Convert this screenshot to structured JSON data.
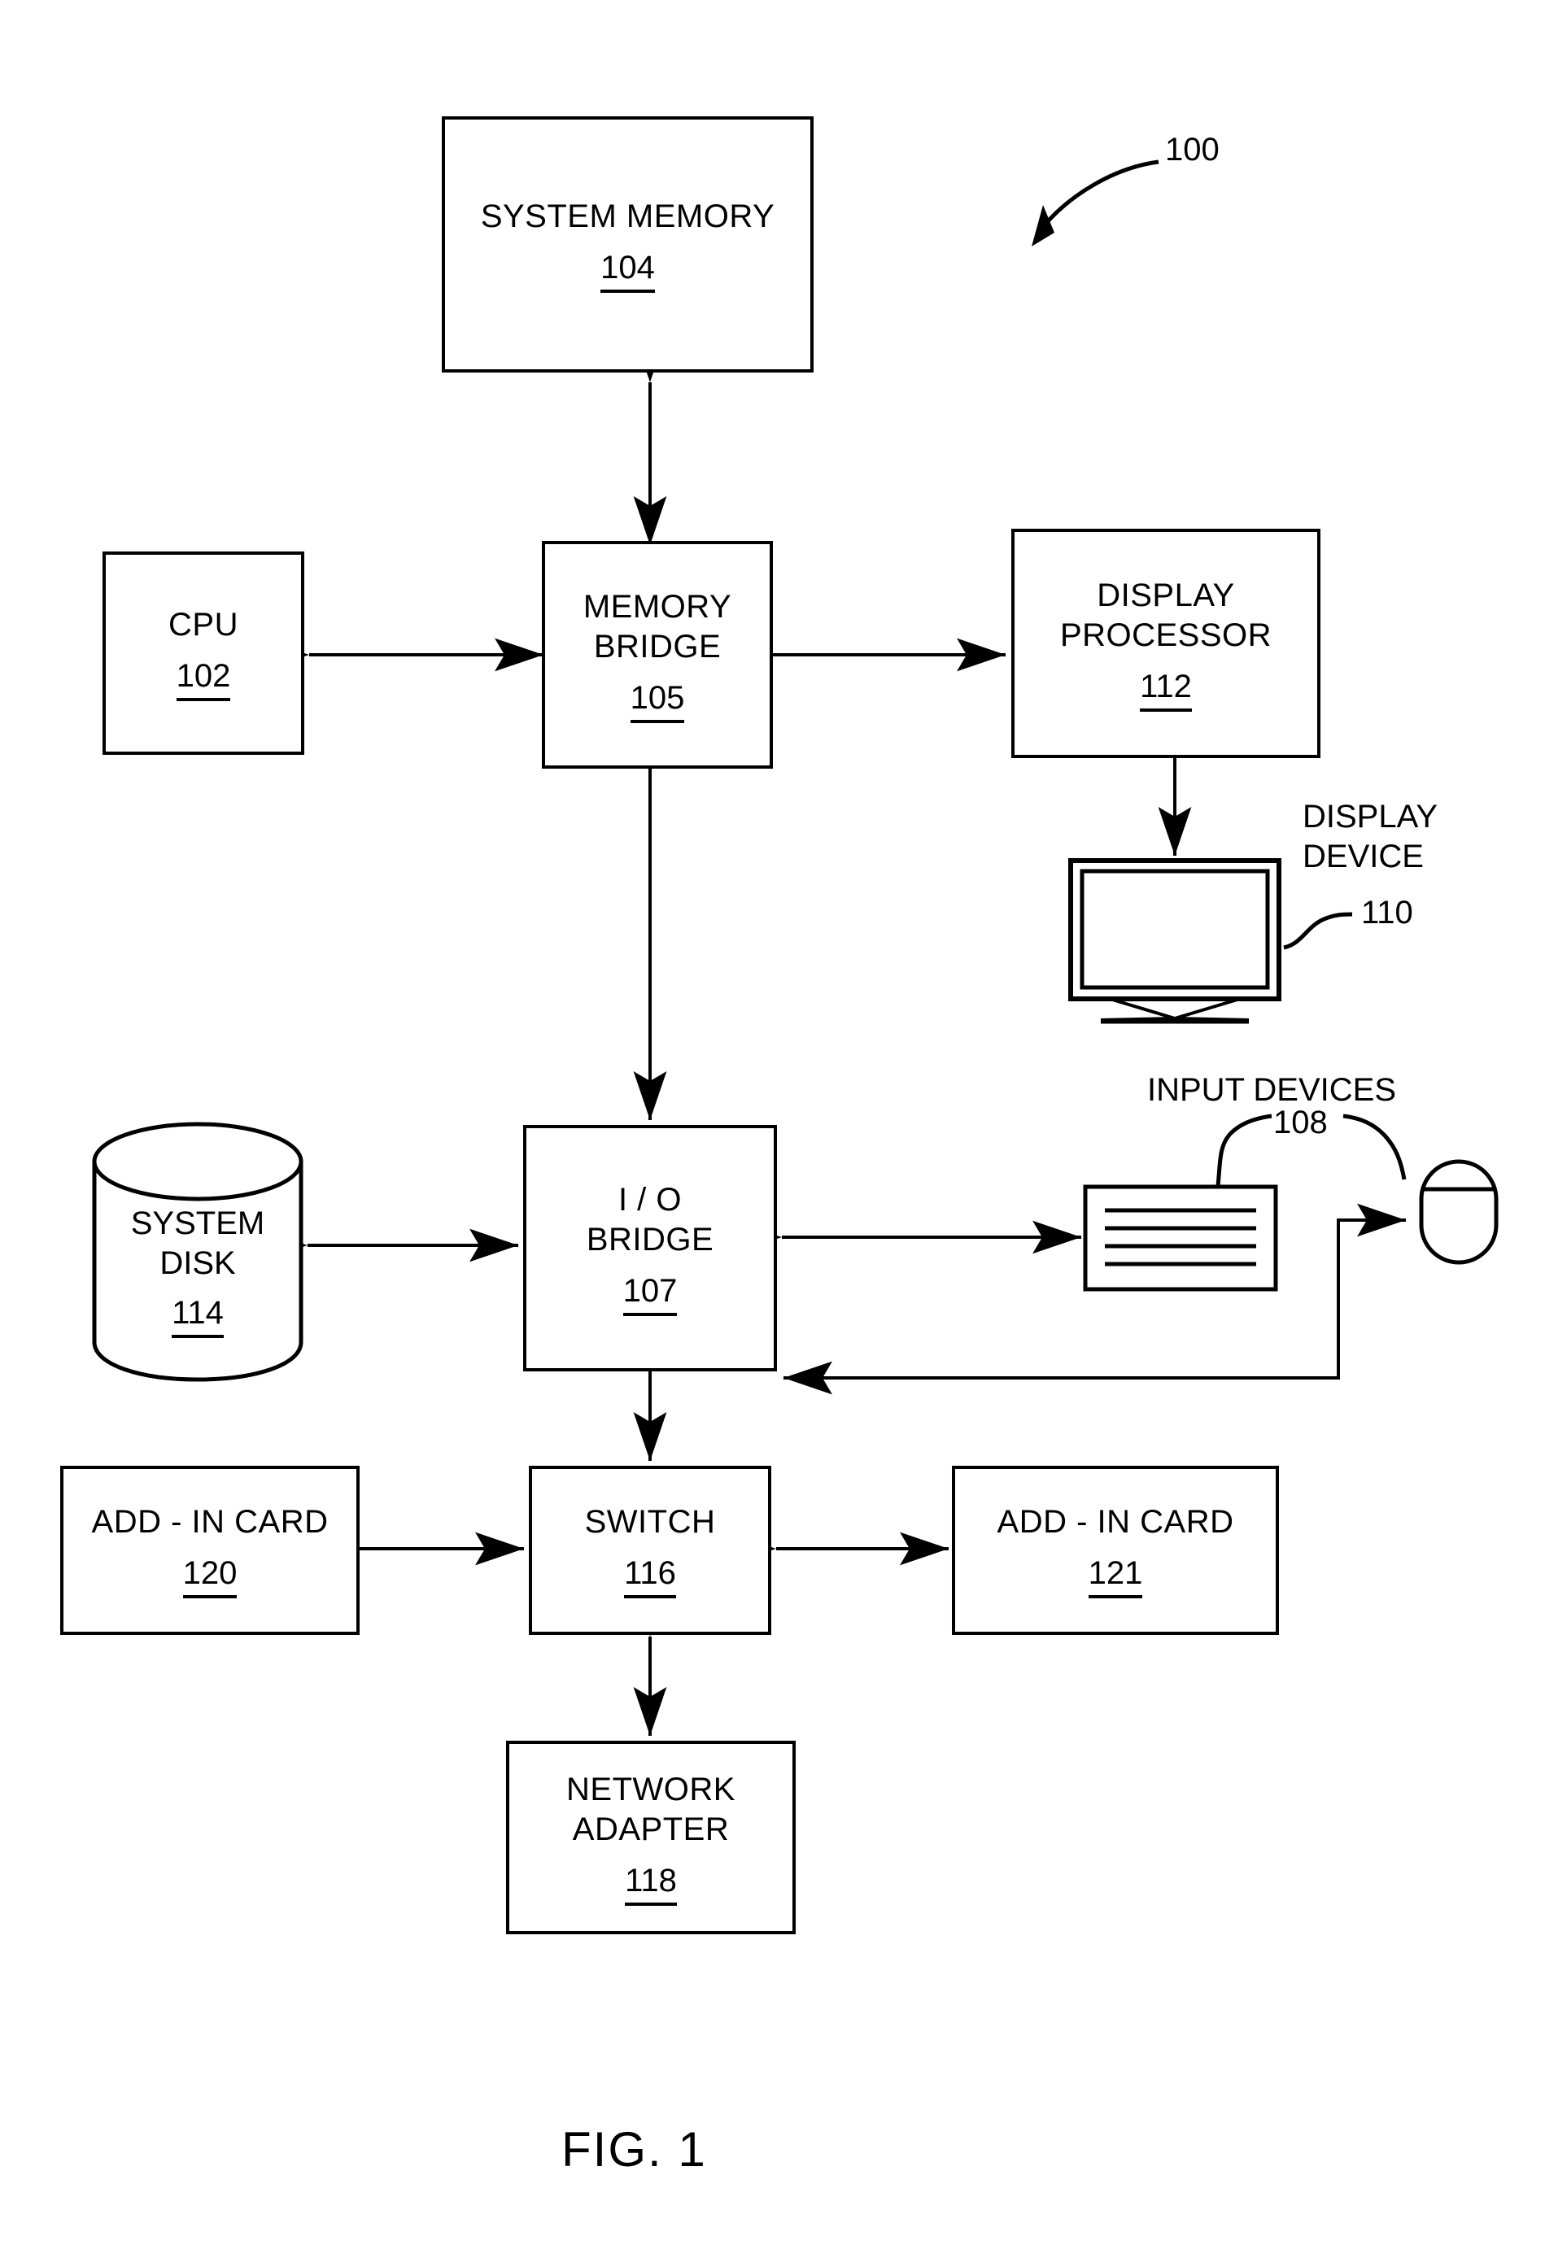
{
  "figure": {
    "caption": "FIG. 1",
    "system_ref": "100"
  },
  "nodes": {
    "system_memory": {
      "title": "SYSTEM MEMORY",
      "ref": "104"
    },
    "cpu": {
      "title": "CPU",
      "ref": "102"
    },
    "memory_bridge": {
      "title": "MEMORY\nBRIDGE",
      "ref": "105"
    },
    "display_processor": {
      "title": "DISPLAY\nPROCESSOR",
      "ref": "112"
    },
    "io_bridge": {
      "title": "I / O\nBRIDGE",
      "ref": "107"
    },
    "system_disk": {
      "title": "SYSTEM\nDISK",
      "ref": "114"
    },
    "switch": {
      "title": "SWITCH",
      "ref": "116"
    },
    "add_in_card_left": {
      "title": "ADD - IN CARD",
      "ref": "120"
    },
    "add_in_card_right": {
      "title": "ADD - IN CARD",
      "ref": "121"
    },
    "network_adapter": {
      "title": "NETWORK\nADAPTER",
      "ref": "118"
    }
  },
  "labels": {
    "display_device": {
      "text": "DISPLAY\nDEVICE",
      "ref": "110"
    },
    "input_devices": {
      "text": "INPUT  DEVICES",
      "ref": "108"
    }
  },
  "colors": {
    "stroke": "#000000",
    "background": "#ffffff"
  }
}
